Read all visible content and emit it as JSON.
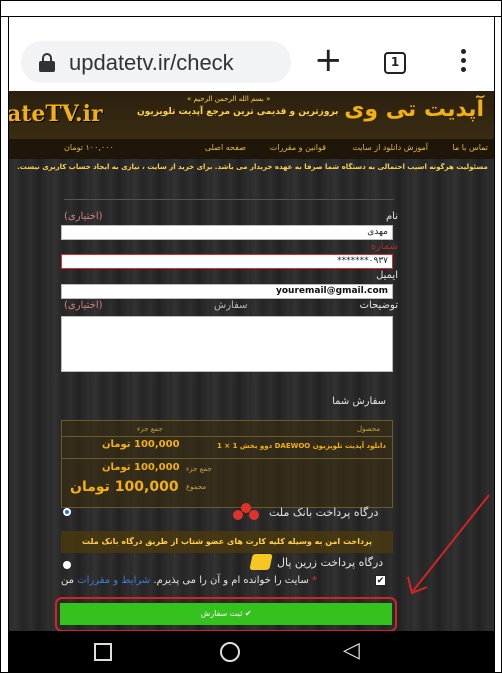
{
  "browser": {
    "url": "updatetv.ir/check",
    "tab_count": "1",
    "new_tab_glyph": "+"
  },
  "header": {
    "logo_en": "ateTV.ir",
    "logo_fa": "آپدیت تی وی",
    "bismillah": "« بسم الله الرحمن الرحیم »",
    "tagline": "بروزترین و قدیمی ترین مرجع آپدیت تلویزیون"
  },
  "nav": {
    "items": [
      "تماس با ما",
      "آموزش دانلود از سایت",
      "قوانین و مقررات",
      "صفحه اصلی"
    ],
    "cart": "۱۰۰,۰۰۰ تومان"
  },
  "notice": "مسئولیت هرگونه آسیب احتمالی به دستگاه شما صرفا به عهده خریدار می باشد. برای خرید از سایت ، نیازی به ایجاد حساب کاربری نیست.",
  "form": {
    "name_label": "نام",
    "name_optional": "(اختیاری)",
    "name_value": "مهدی",
    "phone_label": "شماره",
    "phone_value": "۰۹۳۷*******",
    "email_label": "ایمیل",
    "email_value": "youremail@gmail.com",
    "desc_label": "توضیحات",
    "desc_optional": "(اختیاری)",
    "order_col": "سفارش"
  },
  "order": {
    "title": "سفارش شما",
    "col_product": "محصول",
    "col_total": "جمع جزء",
    "product": "دانلود آپدیت تلویزیون DAEWOO دوو بخش 1 × 1",
    "product_price": "100,000 تومان",
    "subtotal_label": "جمع جزء",
    "subtotal": "100,000 تومان",
    "total_label": "مجموع",
    "total": "100,000 تومان"
  },
  "payment": {
    "mellat_label": "درگاه پرداخت بانک ملت",
    "mellat_desc": "پرداخت امن به وسیله کلیه کارت های عضو شتاب از طریق درگاه بانک ملت",
    "zarinpal_label": "درگاه پرداخت زرین پال",
    "terms_prefix": "من",
    "terms_link": "شرایط و مقررات",
    "terms_suffix": "سایت را خوانده ام و آن را می پذیرم.",
    "terms_star": "*",
    "submit": "✔ ثبت سفارش"
  },
  "colors": {
    "accent": "#f2b10f",
    "submit": "#35c21e",
    "highlight": "#d12525"
  }
}
